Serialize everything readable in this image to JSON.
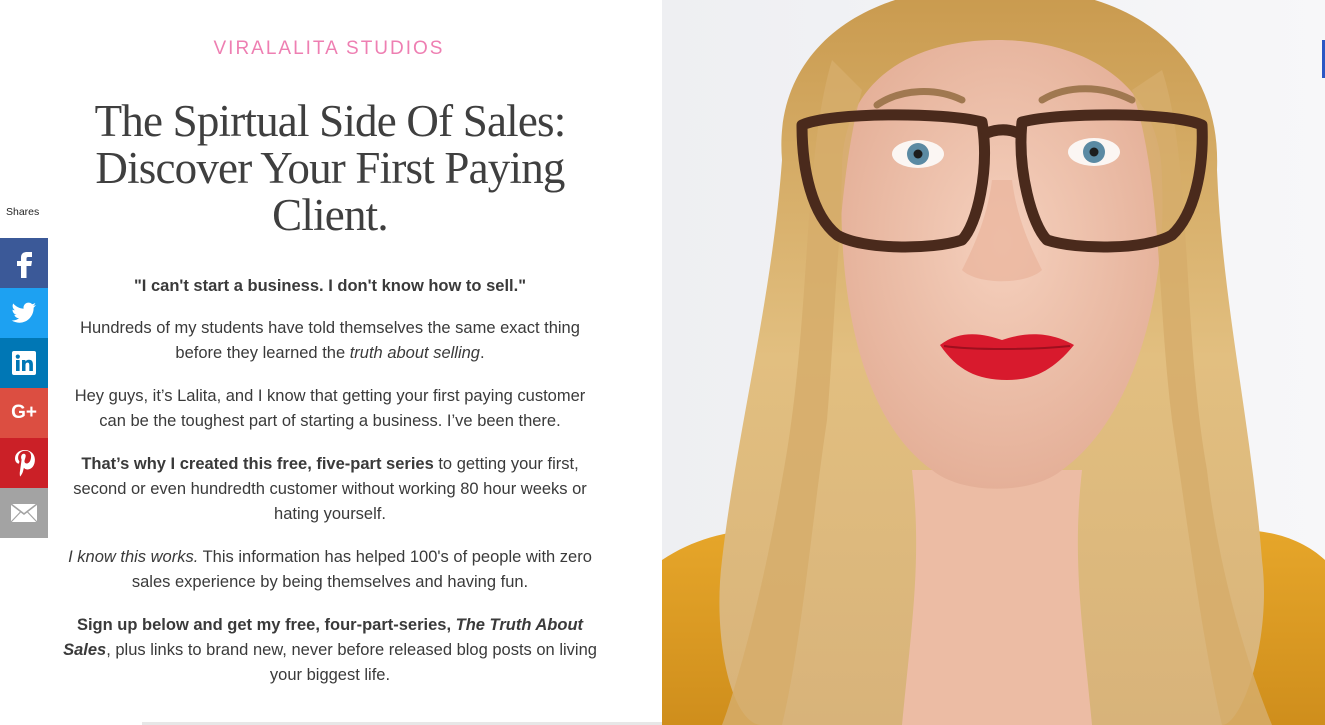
{
  "brand": "VIRALALITA STUDIOS",
  "title": "The Spirtual Side Of Sales: Discover Your First Paying Client.",
  "body": {
    "quote": "\"I can't start a business. I don't know how to sell.\"",
    "p1_text": "Hundreds of my students have told themselves the same exact thing before they learned the ",
    "p1_italic": "truth about selling",
    "p1_end": ".",
    "p2": "Hey guys, it’s Lalita, and I know that getting your first paying customer can be the toughest part of starting a business. I’ve been there.",
    "p3_bold": "That’s why I created this free, five-part series",
    "p3_text": " to getting your first, second or even hundredth customer without working 80 hour weeks or hating yourself.",
    "p4_italic": "I know this works.",
    "p4_text": " This information has helped 100's of people with zero sales experience by being themselves and having fun.",
    "p5_bold": "Sign up below and get my free, four-part-series, ",
    "p5_bold_italic": "The Truth About Sales",
    "p5_text": ", plus links to brand new, never before released blog posts on living your biggest life."
  },
  "share": {
    "label": "Shares",
    "buttons": [
      {
        "network": "facebook",
        "icon": "facebook-icon",
        "color": "#3b5998"
      },
      {
        "network": "twitter",
        "icon": "twitter-icon",
        "color": "#1da1f2"
      },
      {
        "network": "linkedin",
        "icon": "linkedin-icon",
        "color": "#0077b5"
      },
      {
        "network": "google-plus",
        "icon": "google-plus-icon",
        "color": "#dc4e41"
      },
      {
        "network": "pinterest",
        "icon": "pinterest-icon",
        "color": "#cb2027"
      },
      {
        "network": "email",
        "icon": "envelope-icon",
        "color": "#a3a3a3"
      }
    ],
    "google_plus_glyph": "G+"
  },
  "colors": {
    "brand_pink": "#ee7fb2",
    "heading": "#3f3f3f",
    "body_text": "#3a3a3a",
    "lipstick": "#d81a2d",
    "sweater": "#e0a020"
  }
}
